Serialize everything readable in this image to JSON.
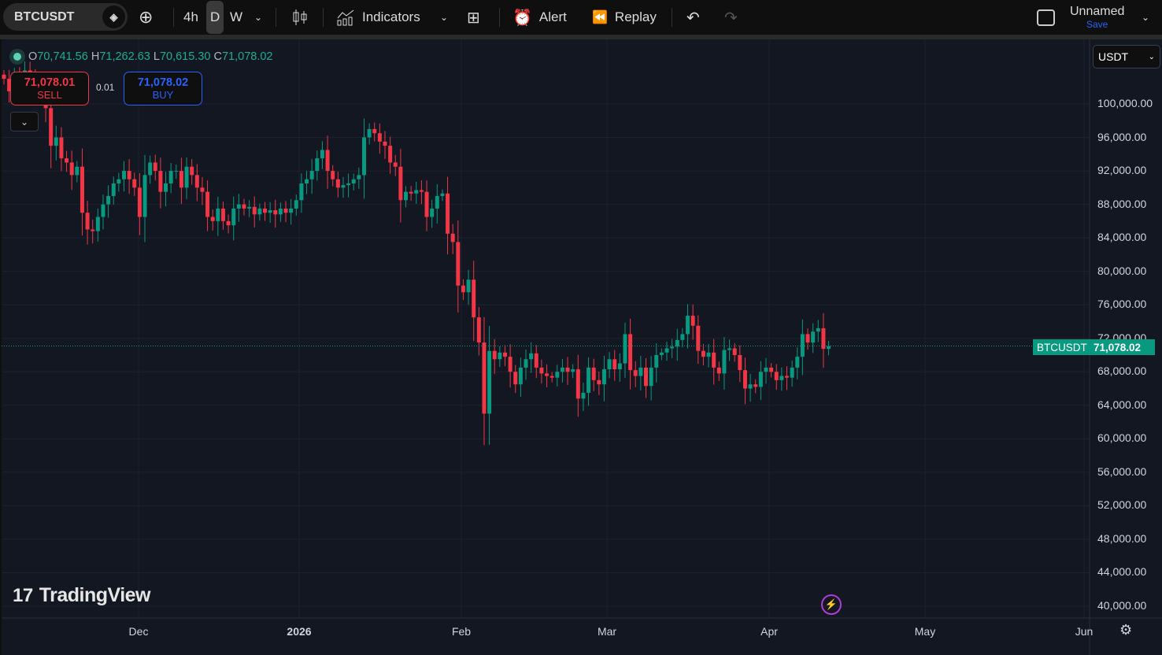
{
  "toolbar": {
    "symbol": "BTCUSDT",
    "intervals": [
      "4h",
      "D",
      "W"
    ],
    "selected_interval": "D",
    "indicators": "Indicators",
    "alert": "Alert",
    "replay": "Replay",
    "layout_name": "Unnamed",
    "save": "Save"
  },
  "legend": {
    "o_label": "O",
    "o": "70,741.56",
    "h_label": "H",
    "h": "71,262.63",
    "l_label": "L",
    "l": "70,615.30",
    "c_label": "C",
    "c": "71,078.02"
  },
  "trade": {
    "sell_price": "71,078.01",
    "sell_label": "SELL",
    "spread": "0.01",
    "buy_price": "71,078.02",
    "buy_label": "BUY"
  },
  "currency": "USDT",
  "price_axis": [
    "100,000.00",
    "96,000.00",
    "92,000.00",
    "88,000.00",
    "84,000.00",
    "80,000.00",
    "76,000.00",
    "72,000.00",
    "68,000.00",
    "64,000.00",
    "60,000.00",
    "56,000.00",
    "52,000.00",
    "48,000.00",
    "44,000.00",
    "40,000.00"
  ],
  "time_axis": [
    "Dec",
    "2026",
    "Feb",
    "Mar",
    "Apr",
    "May",
    "Jun"
  ],
  "last_price": {
    "symbol": "BTCUSDT",
    "value": "71,078.02"
  },
  "brand": "TradingView",
  "colors": {
    "up": "#089981",
    "down": "#f23645",
    "bg": "#131722"
  },
  "chart_data": {
    "type": "candlestick",
    "symbol": "BTCUSDT",
    "interval": "D",
    "ylim": [
      40000,
      104000
    ],
    "closes": [
      103000,
      101500,
      103000,
      102000,
      104000,
      103000,
      102500,
      102000,
      99500,
      95000,
      96000,
      93500,
      93000,
      91500,
      92500,
      87000,
      85000,
      84800,
      86500,
      88000,
      89000,
      90500,
      91000,
      92000,
      91000,
      90000,
      86500,
      91500,
      93000,
      92000,
      89500,
      90500,
      92000,
      92000,
      90000,
      92500,
      91500,
      90000,
      89500,
      86500,
      86000,
      87500,
      86000,
      85500,
      87500,
      88000,
      87500,
      87700,
      86800,
      87500,
      87000,
      87300,
      86800,
      87500,
      87000,
      87500,
      88500,
      90500,
      91000,
      92000,
      93500,
      94500,
      92000,
      91000,
      90000,
      90300,
      90500,
      91000,
      91500,
      96000,
      97000,
      96500,
      95500,
      95000,
      93000,
      92500,
      88500,
      89500,
      89300,
      89700,
      89500,
      86500,
      87500,
      89000,
      89300,
      84500,
      83500,
      78300,
      77500,
      79000,
      74500,
      71500,
      63000,
      70500,
      69500,
      70300,
      69800,
      68000,
      66500,
      68500,
      69500,
      70200,
      68500,
      67800,
      67500,
      67300,
      68000,
      68500,
      68000,
      68300,
      64800,
      65500,
      68500,
      67000,
      66500,
      68300,
      69500,
      68300,
      69000,
      72500,
      68200,
      67500,
      68500,
      66300,
      68500,
      70000,
      70300,
      70800,
      71000,
      71800,
      72500,
      74700,
      73500,
      70500,
      69800,
      70300,
      68500,
      67800,
      70600,
      70800,
      70000,
      68200,
      66000,
      66500,
      66200,
      68000,
      68500,
      68000,
      67000,
      67500,
      67300,
      68500,
      69800,
      72500,
      71500,
      72800,
      73200,
      70741.56,
      71078.02
    ]
  }
}
